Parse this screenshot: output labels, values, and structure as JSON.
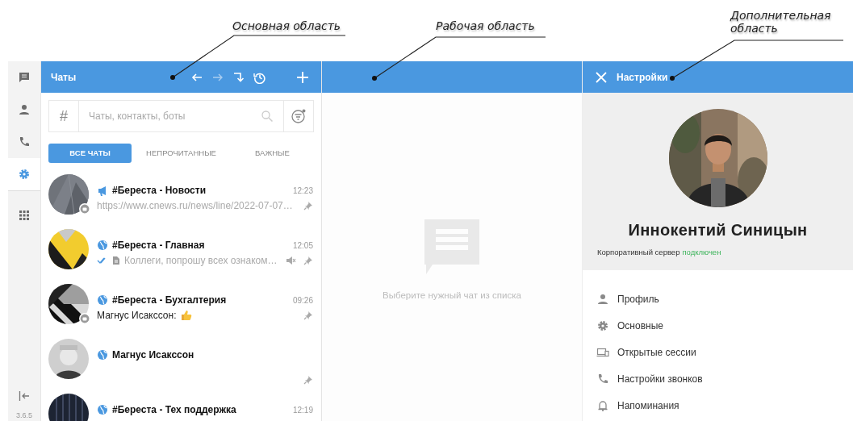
{
  "annotations": [
    {
      "text": "Основная область"
    },
    {
      "text": "Рабочая область"
    },
    {
      "text": "Дополнительная область"
    }
  ],
  "rail": {
    "items": [
      {
        "kind": "chat",
        "selected": false
      },
      {
        "kind": "contacts",
        "selected": false
      },
      {
        "kind": "calls",
        "selected": false
      },
      {
        "kind": "settings",
        "selected": true
      },
      {
        "kind": "apps",
        "selected": false
      }
    ],
    "version": "3.6.5"
  },
  "main": {
    "title": "Чаты",
    "search": {
      "prefix": "#",
      "placeholder": "Чаты, контакты, боты"
    },
    "tabs": [
      {
        "label": "ВСЕ ЧАТЫ",
        "selected": true
      },
      {
        "label": "НЕПРОЧИТАННЫЕ",
        "selected": false
      },
      {
        "label": "ВАЖНЫЕ",
        "selected": false
      }
    ],
    "chats": [
      {
        "kind": "announcement",
        "name": "#Береста - Новости",
        "time": "12:23",
        "preview": "https://www.cnews.ru/news/line/2022-07-07…",
        "unread": false,
        "badge": true,
        "pinned": true
      },
      {
        "kind": "public",
        "name": "#Береста - Главная",
        "time": "12:05",
        "preview": "Коллеги, попрошу всех ознаком…",
        "unread": false,
        "ticks": true,
        "attachment": true,
        "muted": true,
        "pinned": true
      },
      {
        "kind": "public",
        "name": "#Береста - Бухгалтерия",
        "time": "09:26",
        "preview": "Магнус Исакссон:",
        "unread": true,
        "emoji": true,
        "badge": true,
        "pinned": true
      },
      {
        "kind": "public",
        "name": "Магнус Исакссон",
        "pinned": true
      },
      {
        "kind": "public",
        "name": "#Береста - Тех поддержка",
        "time": "12:19"
      }
    ]
  },
  "work": {
    "empty_text": "Выберите нужный чат из списка"
  },
  "extra": {
    "title": "Настройки",
    "profile": {
      "name": "Иннокентий Синицын",
      "server_label": "Корпоративный сервер",
      "server_status": "подключен",
      "connected": true
    },
    "menu": [
      {
        "kind": "person",
        "label": "Профиль"
      },
      {
        "kind": "gear",
        "label": "Основные"
      },
      {
        "kind": "sessions",
        "label": "Открытые сессии"
      },
      {
        "kind": "phone",
        "label": "Настройки звонков"
      },
      {
        "kind": "bell",
        "label": "Напоминания"
      }
    ]
  }
}
